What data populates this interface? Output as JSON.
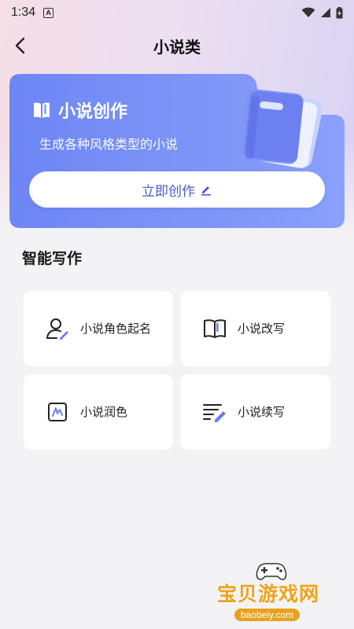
{
  "status_bar": {
    "time": "1:34",
    "notification_letter": "A"
  },
  "header": {
    "title": "小说类"
  },
  "hero": {
    "title": "小说创作",
    "subtitle": "生成各种风格类型的小说",
    "button_label": "立即创作"
  },
  "section": {
    "title": "智能写作",
    "cards": [
      {
        "label": "小说角色起名",
        "icon": "user-edit-icon"
      },
      {
        "label": "小说改写",
        "icon": "open-book-icon"
      },
      {
        "label": "小说润色",
        "icon": "polish-signature-icon"
      },
      {
        "label": "小说续写",
        "icon": "continue-writing-icon"
      }
    ]
  },
  "watermark": {
    "title": "宝贝游戏网",
    "url": "baobeiy.com"
  },
  "colors": {
    "accent": "#4a5ad0",
    "hero_blue": "#6f87f4",
    "watermark_orange": "#f0a21b"
  }
}
